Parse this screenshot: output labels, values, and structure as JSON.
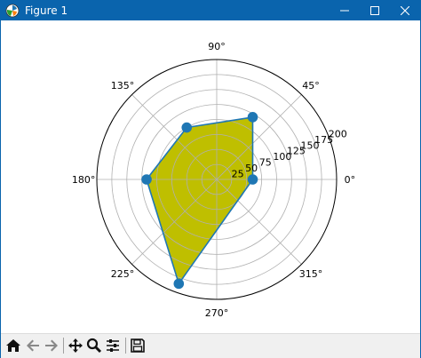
{
  "window": {
    "title": "Figure 1"
  },
  "toolbar": {
    "buttons": [
      "home-icon",
      "back-icon",
      "forward-icon",
      "pan-icon",
      "zoom-icon",
      "configure-subplots-icon",
      "save-icon"
    ]
  },
  "chart_data": {
    "type": "polar-filled",
    "angular_ticks": [
      "0°",
      "45°",
      "90°",
      "135°",
      "180°",
      "225°",
      "270°",
      "315°"
    ],
    "radial_ticks": [
      "25",
      "50",
      "75",
      "100",
      "125",
      "150",
      "175",
      "200"
    ],
    "rlim": [
      0,
      200
    ],
    "grid": true,
    "points": [
      {
        "theta_deg": 0,
        "r": 60
      },
      {
        "theta_deg": 60,
        "r": 120
      },
      {
        "theta_deg": 120,
        "r": 100
      },
      {
        "theta_deg": 180,
        "r": 117
      },
      {
        "theta_deg": 250,
        "r": 185
      }
    ],
    "colors": {
      "fill": "#bfbf00",
      "line": "#1f77b4",
      "marker": "#1f77b4",
      "grid": "#b0b0b0"
    }
  }
}
